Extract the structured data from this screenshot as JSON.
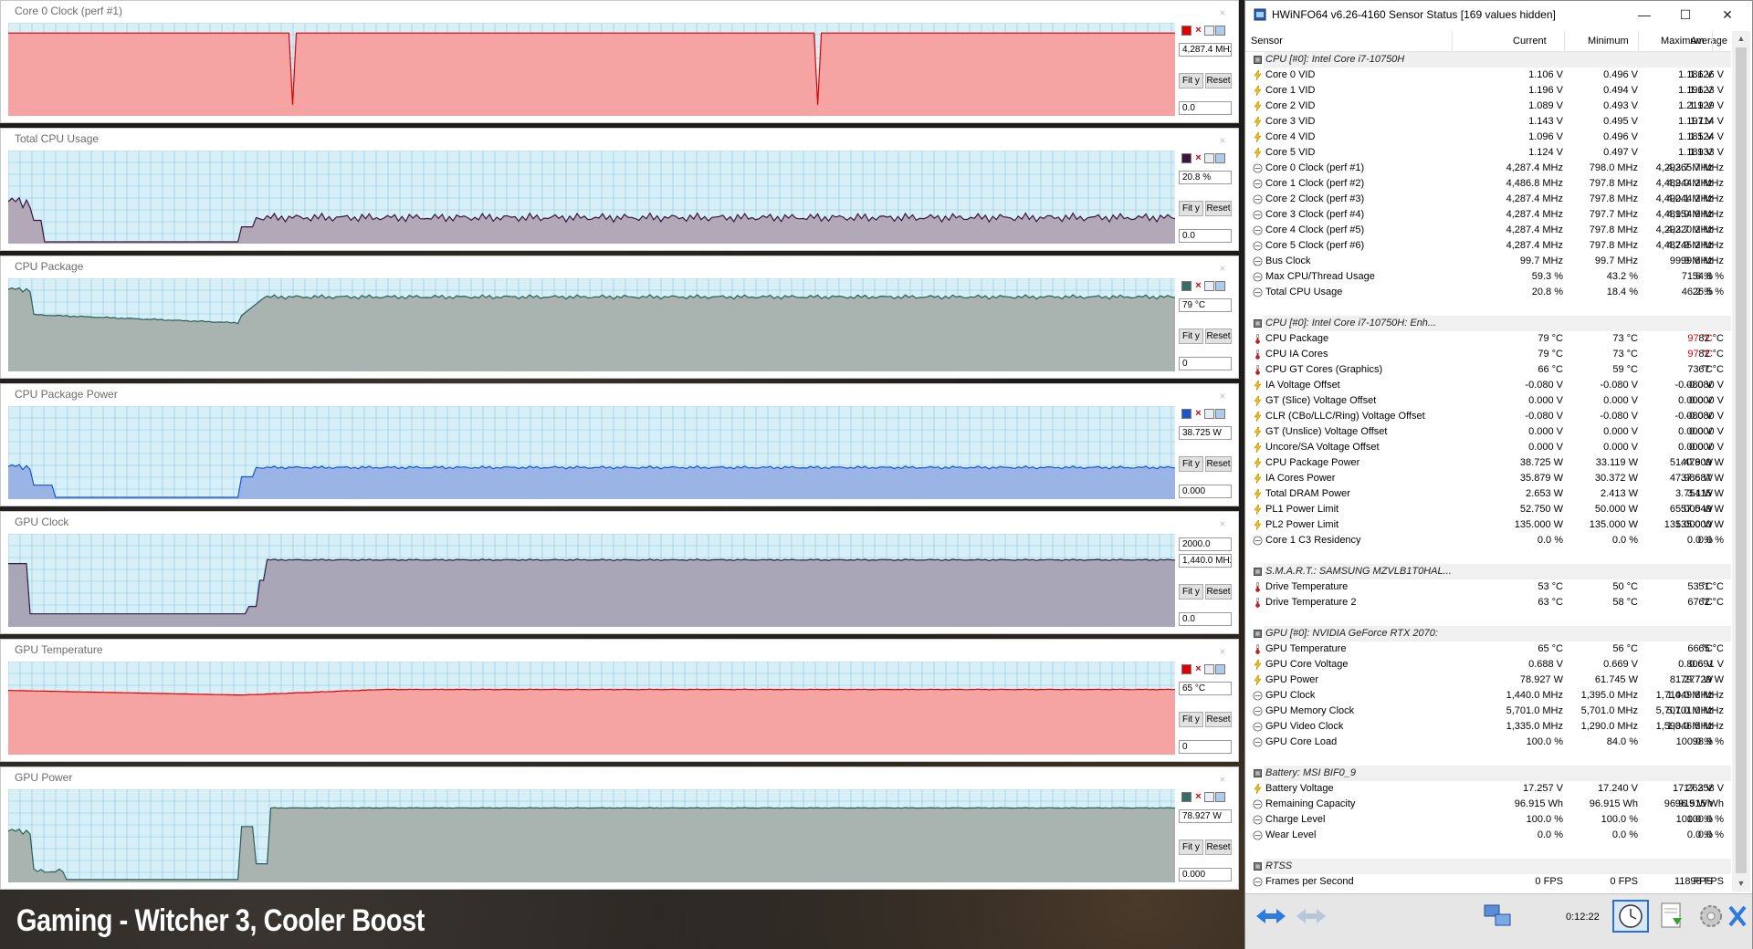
{
  "caption": "Gaming - Witcher 3, Cooler Boost",
  "graphs": [
    {
      "title": "Core 0 Clock (perf #1)",
      "current": "4,287.4 MHz",
      "min": "0.0",
      "max": "",
      "fill": "#f5a3a3",
      "line": "#e00000",
      "swatch": "#e00000",
      "level": 0.89,
      "profile": "flat_dips",
      "fit_label": "Fit y",
      "reset_label": "Reset"
    },
    {
      "title": "Total CPU Usage",
      "current": "20.8 %",
      "min": "0.0",
      "max": "",
      "fill": "#b3a8b8",
      "line": "#3a1540",
      "swatch": "#3a1540",
      "level": 0.2,
      "profile": "usage",
      "fit_label": "Fit y",
      "reset_label": "Reset"
    },
    {
      "title": "CPU Package",
      "current": "79 °C",
      "min": "0",
      "max": "",
      "fill": "#a9b3b0",
      "line": "#2a5f57",
      "swatch": "#3a6b65",
      "level": 0.79,
      "profile": "temp",
      "fit_label": "Fit y",
      "reset_label": "Reset"
    },
    {
      "title": "CPU Package Power",
      "current": "38.725 W",
      "min": "0.000",
      "max": "",
      "fill": "#9ab4e6",
      "line": "#1a56c8",
      "swatch": "#1a56c8",
      "level": 0.38,
      "profile": "power",
      "fit_label": "Fit y",
      "reset_label": "Reset"
    },
    {
      "title": "GPU Clock",
      "current": "1,440.0 MHz",
      "min": "0.0",
      "max": "2000.0",
      "fill": "#a9a6b8",
      "line": "#2a2040",
      "swatch": "#4a3a60",
      "level": 0.72,
      "profile": "gpuclock",
      "fit_label": "Fit y",
      "reset_label": "Reset"
    },
    {
      "title": "GPU Temperature",
      "current": "65 °C",
      "min": "0",
      "max": "",
      "fill": "#f5a3a3",
      "line": "#e00000",
      "swatch": "#e00000",
      "level": 0.65,
      "profile": "gputemp",
      "fit_label": "Fit y",
      "reset_label": "Reset"
    },
    {
      "title": "GPU Power",
      "current": "78.927 W",
      "min": "0.000",
      "max": "",
      "fill": "#a9b3b0",
      "line": "#2a5f57",
      "swatch": "#3a6b65",
      "level": 0.8,
      "profile": "gpupower",
      "fit_label": "Fit y",
      "reset_label": "Reset"
    }
  ],
  "hwinfo": {
    "title": "HWiNFO64 v6.26-4160 Sensor Status [169 values hidden]",
    "columns": [
      "Sensor",
      "Current",
      "Minimum",
      "Maximum",
      "Average"
    ],
    "timer": "0:12:22",
    "rows": [
      {
        "type": "group",
        "label": "CPU [#0]: Intel Core i7-10750H"
      },
      {
        "icon": "volt",
        "label": "Core 0 VID",
        "v": [
          "1.106 V",
          "0.496 V",
          "1.186 V",
          "1.126 V"
        ]
      },
      {
        "icon": "volt",
        "label": "Core 1 VID",
        "v": [
          "1.196 V",
          "0.494 V",
          "1.196 V",
          "1.123 V"
        ]
      },
      {
        "icon": "volt",
        "label": "Core 2 VID",
        "v": [
          "1.089 V",
          "0.493 V",
          "1.219 V",
          "1.129 V"
        ]
      },
      {
        "icon": "volt",
        "label": "Core 3 VID",
        "v": [
          "1.143 V",
          "0.495 V",
          "1.197 V",
          "1.114 V"
        ]
      },
      {
        "icon": "volt",
        "label": "Core 4 VID",
        "v": [
          "1.096 V",
          "0.496 V",
          "1.185 V",
          "1.124 V"
        ]
      },
      {
        "icon": "volt",
        "label": "Core 5 VID",
        "v": [
          "1.124 V",
          "0.497 V",
          "1.189 V",
          "1.133 V"
        ]
      },
      {
        "icon": "clock",
        "label": "Core 0 Clock (perf #1)",
        "v": [
          "4,287.4 MHz",
          "798.0 MHz",
          "4,293.7 MHz",
          "4,265.7 MHz"
        ]
      },
      {
        "icon": "clock",
        "label": "Core 1 Clock (perf #2)",
        "v": [
          "4,486.8 MHz",
          "797.8 MHz",
          "4,489.0 MHz",
          "4,244.2 MHz"
        ]
      },
      {
        "icon": "clock",
        "label": "Core 2 Clock (perf #3)",
        "v": [
          "4,287.4 MHz",
          "797.8 MHz",
          "4,490.1 MHz",
          "4,244.2 MHz"
        ]
      },
      {
        "icon": "clock",
        "label": "Core 3 Clock (perf #4)",
        "v": [
          "4,287.4 MHz",
          "797.7 MHz",
          "4,489.0 MHz",
          "4,154.9 MHz"
        ]
      },
      {
        "icon": "clock",
        "label": "Core 4 Clock (perf #5)",
        "v": [
          "4,287.4 MHz",
          "797.8 MHz",
          "4,293.7 MHz",
          "4,220.2 MHz"
        ]
      },
      {
        "icon": "clock",
        "label": "Core 5 Clock (perf #6)",
        "v": [
          "4,287.4 MHz",
          "797.8 MHz",
          "4,487.9 MHz",
          "4,245.2 MHz"
        ]
      },
      {
        "icon": "clock",
        "label": "Bus Clock",
        "v": [
          "99.7 MHz",
          "99.7 MHz",
          "99.9 MHz",
          "99.8 MHz"
        ]
      },
      {
        "icon": "clock",
        "label": "Max CPU/Thread Usage",
        "v": [
          "59.3 %",
          "43.2 %",
          "71.6 %",
          "54.8 %"
        ]
      },
      {
        "icon": "clock",
        "label": "Total CPU Usage",
        "v": [
          "20.8 %",
          "18.4 %",
          "46.2 %",
          "26.5 %"
        ]
      },
      {
        "type": "blank"
      },
      {
        "type": "group",
        "label": "CPU [#0]: Intel Core i7-10750H: Enh..."
      },
      {
        "icon": "temp",
        "label": "CPU Package",
        "v": [
          "79 °C",
          "73 °C",
          "97 °C",
          "82 °C"
        ],
        "red": [
          2
        ]
      },
      {
        "icon": "temp",
        "label": "CPU IA Cores",
        "v": [
          "79 °C",
          "73 °C",
          "97 °C",
          "82 °C"
        ],
        "red": [
          2
        ]
      },
      {
        "icon": "temp",
        "label": "CPU GT Cores (Graphics)",
        "v": [
          "66 °C",
          "59 °C",
          "73 °C",
          "67 °C"
        ]
      },
      {
        "icon": "volt",
        "label": "IA Voltage Offset",
        "v": [
          "-0.080 V",
          "-0.080 V",
          "-0.080 V",
          "-0.080 V"
        ]
      },
      {
        "icon": "volt",
        "label": "GT (Slice) Voltage Offset",
        "v": [
          "0.000 V",
          "0.000 V",
          "0.000 V",
          "0.000 V"
        ]
      },
      {
        "icon": "volt",
        "label": "CLR (CBo/LLC/Ring) Voltage Offset",
        "v": [
          "-0.080 V",
          "-0.080 V",
          "-0.080 V",
          "-0.080 V"
        ]
      },
      {
        "icon": "volt",
        "label": "GT (Unslice) Voltage Offset",
        "v": [
          "0.000 V",
          "0.000 V",
          "0.000 V",
          "0.000 V"
        ]
      },
      {
        "icon": "volt",
        "label": "Uncore/SA Voltage Offset",
        "v": [
          "0.000 V",
          "0.000 V",
          "0.000 V",
          "0.000 V"
        ]
      },
      {
        "icon": "volt",
        "label": "CPU Package Power",
        "v": [
          "38.725 W",
          "33.119 W",
          "51.479 W",
          "40.809 W"
        ]
      },
      {
        "icon": "volt",
        "label": "IA Cores Power",
        "v": [
          "35.879 W",
          "30.372 W",
          "47.986 W",
          "37.687 W"
        ]
      },
      {
        "icon": "volt",
        "label": "Total DRAM Power",
        "v": [
          "2.653 W",
          "2.413 W",
          "3.754 W",
          "3.115 W"
        ]
      },
      {
        "icon": "volt",
        "label": "PL1 Power Limit",
        "v": [
          "52.750 W",
          "50.000 W",
          "65.000 W",
          "57.549 W"
        ]
      },
      {
        "icon": "volt",
        "label": "PL2 Power Limit",
        "v": [
          "135.000 W",
          "135.000 W",
          "135.000 W",
          "135.000 W"
        ]
      },
      {
        "icon": "clock",
        "label": "Core 1 C3 Residency",
        "v": [
          "0.0 %",
          "0.0 %",
          "0.0 %",
          "0.0 %"
        ]
      },
      {
        "type": "blank"
      },
      {
        "type": "group",
        "label": "S.M.A.R.T.: SAMSUNG MZVLB1T0HAL..."
      },
      {
        "icon": "temp",
        "label": "Drive Temperature",
        "v": [
          "53 °C",
          "50 °C",
          "53 °C",
          "51 °C"
        ]
      },
      {
        "icon": "temp",
        "label": "Drive Temperature 2",
        "v": [
          "63 °C",
          "58 °C",
          "67 °C",
          "62 °C"
        ]
      },
      {
        "type": "blank"
      },
      {
        "type": "group",
        "label": "GPU [#0]: NVIDIA GeForce RTX 2070:"
      },
      {
        "icon": "temp",
        "label": "GPU Temperature",
        "v": [
          "65 °C",
          "56 °C",
          "66 °C",
          "65 °C"
        ]
      },
      {
        "icon": "volt",
        "label": "GPU Core Voltage",
        "v": [
          "0.688 V",
          "0.669 V",
          "0.806 V",
          "0.691 V"
        ]
      },
      {
        "icon": "volt",
        "label": "GPU Power",
        "v": [
          "78.927 W",
          "61.745 W",
          "81.277 W",
          "79.729 W"
        ]
      },
      {
        "icon": "clock",
        "label": "GPU Clock",
        "v": [
          "1,440.0 MHz",
          "1,395.0 MHz",
          "1,710.0 MHz",
          "1,449.8 MHz"
        ]
      },
      {
        "icon": "clock",
        "label": "GPU Memory Clock",
        "v": [
          "5,701.0 MHz",
          "5,701.0 MHz",
          "5,701.0 MHz",
          "5,701.0 MHz"
        ]
      },
      {
        "icon": "clock",
        "label": "GPU Video Clock",
        "v": [
          "1,335.0 MHz",
          "1,290.0 MHz",
          "1,590.0 MHz",
          "1,346.5 MHz"
        ]
      },
      {
        "icon": "clock",
        "label": "GPU Core Load",
        "v": [
          "100.0 %",
          "84.0 %",
          "100.0 %",
          "98.9 %"
        ]
      },
      {
        "type": "blank"
      },
      {
        "type": "group",
        "label": "Battery: MSI BIF0_9"
      },
      {
        "icon": "volt",
        "label": "Battery Voltage",
        "v": [
          "17.257 V",
          "17.240 V",
          "17.263 V",
          "17.258 V"
        ]
      },
      {
        "icon": "clock",
        "label": "Remaining Capacity",
        "v": [
          "96.915 Wh",
          "96.915 Wh",
          "96.915 Wh",
          "96.915 Wh"
        ]
      },
      {
        "icon": "clock",
        "label": "Charge Level",
        "v": [
          "100.0 %",
          "100.0 %",
          "100.0 %",
          "100.0 %"
        ]
      },
      {
        "icon": "clock",
        "label": "Wear Level",
        "v": [
          "0.0 %",
          "0.0 %",
          "0.0 %",
          "0.0 %"
        ]
      },
      {
        "type": "blank"
      },
      {
        "type": "group",
        "label": "RTSS"
      },
      {
        "icon": "clock",
        "label": "Frames per Second",
        "v": [
          "0 FPS",
          "0 FPS",
          "118 FPS",
          "96 FPS"
        ]
      }
    ]
  }
}
